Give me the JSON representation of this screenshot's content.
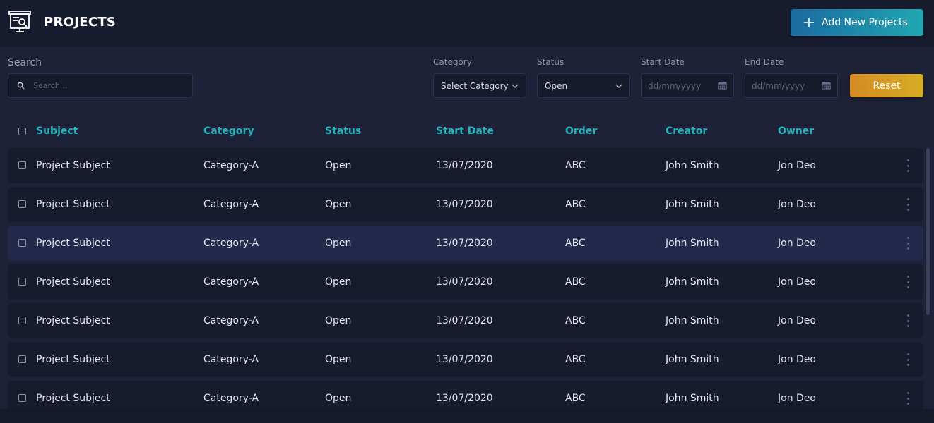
{
  "header": {
    "title": "PROJECTS",
    "add_button_label": "Add New Projects"
  },
  "filters": {
    "search_label": "Search",
    "search_placeholder": "Search...",
    "category_label": "Category",
    "category_value": "Select Category",
    "status_label": "Status",
    "status_value": "Open",
    "start_date_label": "Start Date",
    "start_date_placeholder": "dd/mm/yyyy",
    "end_date_label": "End Date",
    "end_date_placeholder": "dd/mm/yyyy",
    "reset_label": "Reset"
  },
  "table": {
    "columns": [
      "Subject",
      "Category",
      "Status",
      "Start Date",
      "Order",
      "Creator",
      "Owner"
    ],
    "rows": [
      [
        "Project Subject",
        "Category-A",
        "Open",
        "13/07/2020",
        "ABC",
        "John Smith",
        "Jon Deo"
      ],
      [
        "Project Subject",
        "Category-A",
        "Open",
        "13/07/2020",
        "ABC",
        "John Smith",
        "Jon Deo"
      ],
      [
        "Project Subject",
        "Category-A",
        "Open",
        "13/07/2020",
        "ABC",
        "John Smith",
        "Jon Deo"
      ],
      [
        "Project Subject",
        "Category-A",
        "Open",
        "13/07/2020",
        "ABC",
        "John Smith",
        "Jon Deo"
      ],
      [
        "Project Subject",
        "Category-A",
        "Open",
        "13/07/2020",
        "ABC",
        "John Smith",
        "Jon Deo"
      ],
      [
        "Project Subject",
        "Category-A",
        "Open",
        "13/07/2020",
        "ABC",
        "John Smith",
        "Jon Deo"
      ],
      [
        "Project Subject",
        "Category-A",
        "Open",
        "13/07/2020",
        "ABC",
        "John Smith",
        "Jon Deo"
      ]
    ]
  },
  "colors": {
    "accent_teal": "#24b4bd",
    "add_button_gradient": [
      "#1a6aa0",
      "#21a7b2"
    ],
    "reset_button_gradient": [
      "#d48a23",
      "#d6ad24"
    ],
    "background": "#1d2238"
  },
  "icons": {
    "logo": "projects-board-icon",
    "add": "plus-icon",
    "search": "search-icon",
    "dropdown": "chevron-down-icon",
    "date": "calendar-icon",
    "row_menu": "more-vertical-icon"
  }
}
